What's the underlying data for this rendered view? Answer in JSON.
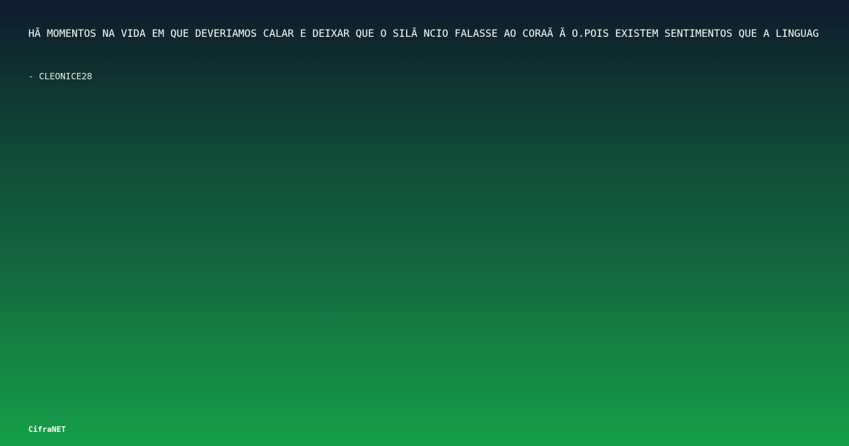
{
  "quote": {
    "text": "HÃ  MOMENTOS NA VIDA EM QUE DEVERIAMOS CALAR E DEIXAR QUE O SILÃ NCIO FALASSE AO CORAÃ Ã O.POIS EXISTEM SENTIMENTOS QUE A LINGUAG"
  },
  "author": {
    "text": "- CLEONICE28"
  },
  "brand": {
    "name": "CifraNET"
  }
}
